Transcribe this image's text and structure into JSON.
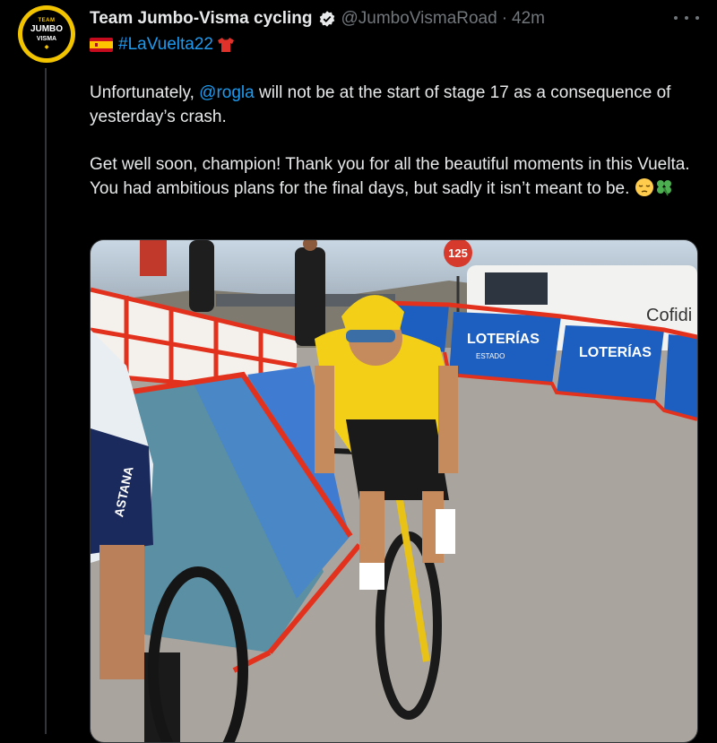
{
  "tweet": {
    "author_name": "Team Jumbo-Visma cycling",
    "handle": "@JumboVismaRoad",
    "separator": "·",
    "time": "42m",
    "hashtag": "#LaVuelta22",
    "text_part1_pre": "Unfortunately, ",
    "mention": "@rogla",
    "text_part1_post": " will not be at the start of stage 17 as a consequence of yesterday’s crash.",
    "text_part2": "Get well soon, champion! Thank you for all the beautiful moments in this Vuelta. You had ambitious plans for the final days, but sadly it isn’t meant to be.",
    "icons": [
      "verified-badge-icon",
      "spain-flag-icon",
      "red-jersey-icon",
      "pensive-face-icon",
      "clover-icon",
      "more-options-icon"
    ]
  },
  "avatar": {
    "line1": "TEAM",
    "line2": "JUMBO",
    "line3": "VISMA"
  },
  "photo": {
    "sign_number": "125",
    "banner_text": "LOTERÍAS",
    "banner_sub": "ESTADO",
    "van_text": "Cofidi",
    "jersey_brand": "ASTANA",
    "colors": {
      "jersey_yellow": "#f3d017",
      "barrier_red": "#e2321d",
      "banner_blue": "#1d5fc0",
      "road": "#a9a59e"
    }
  }
}
